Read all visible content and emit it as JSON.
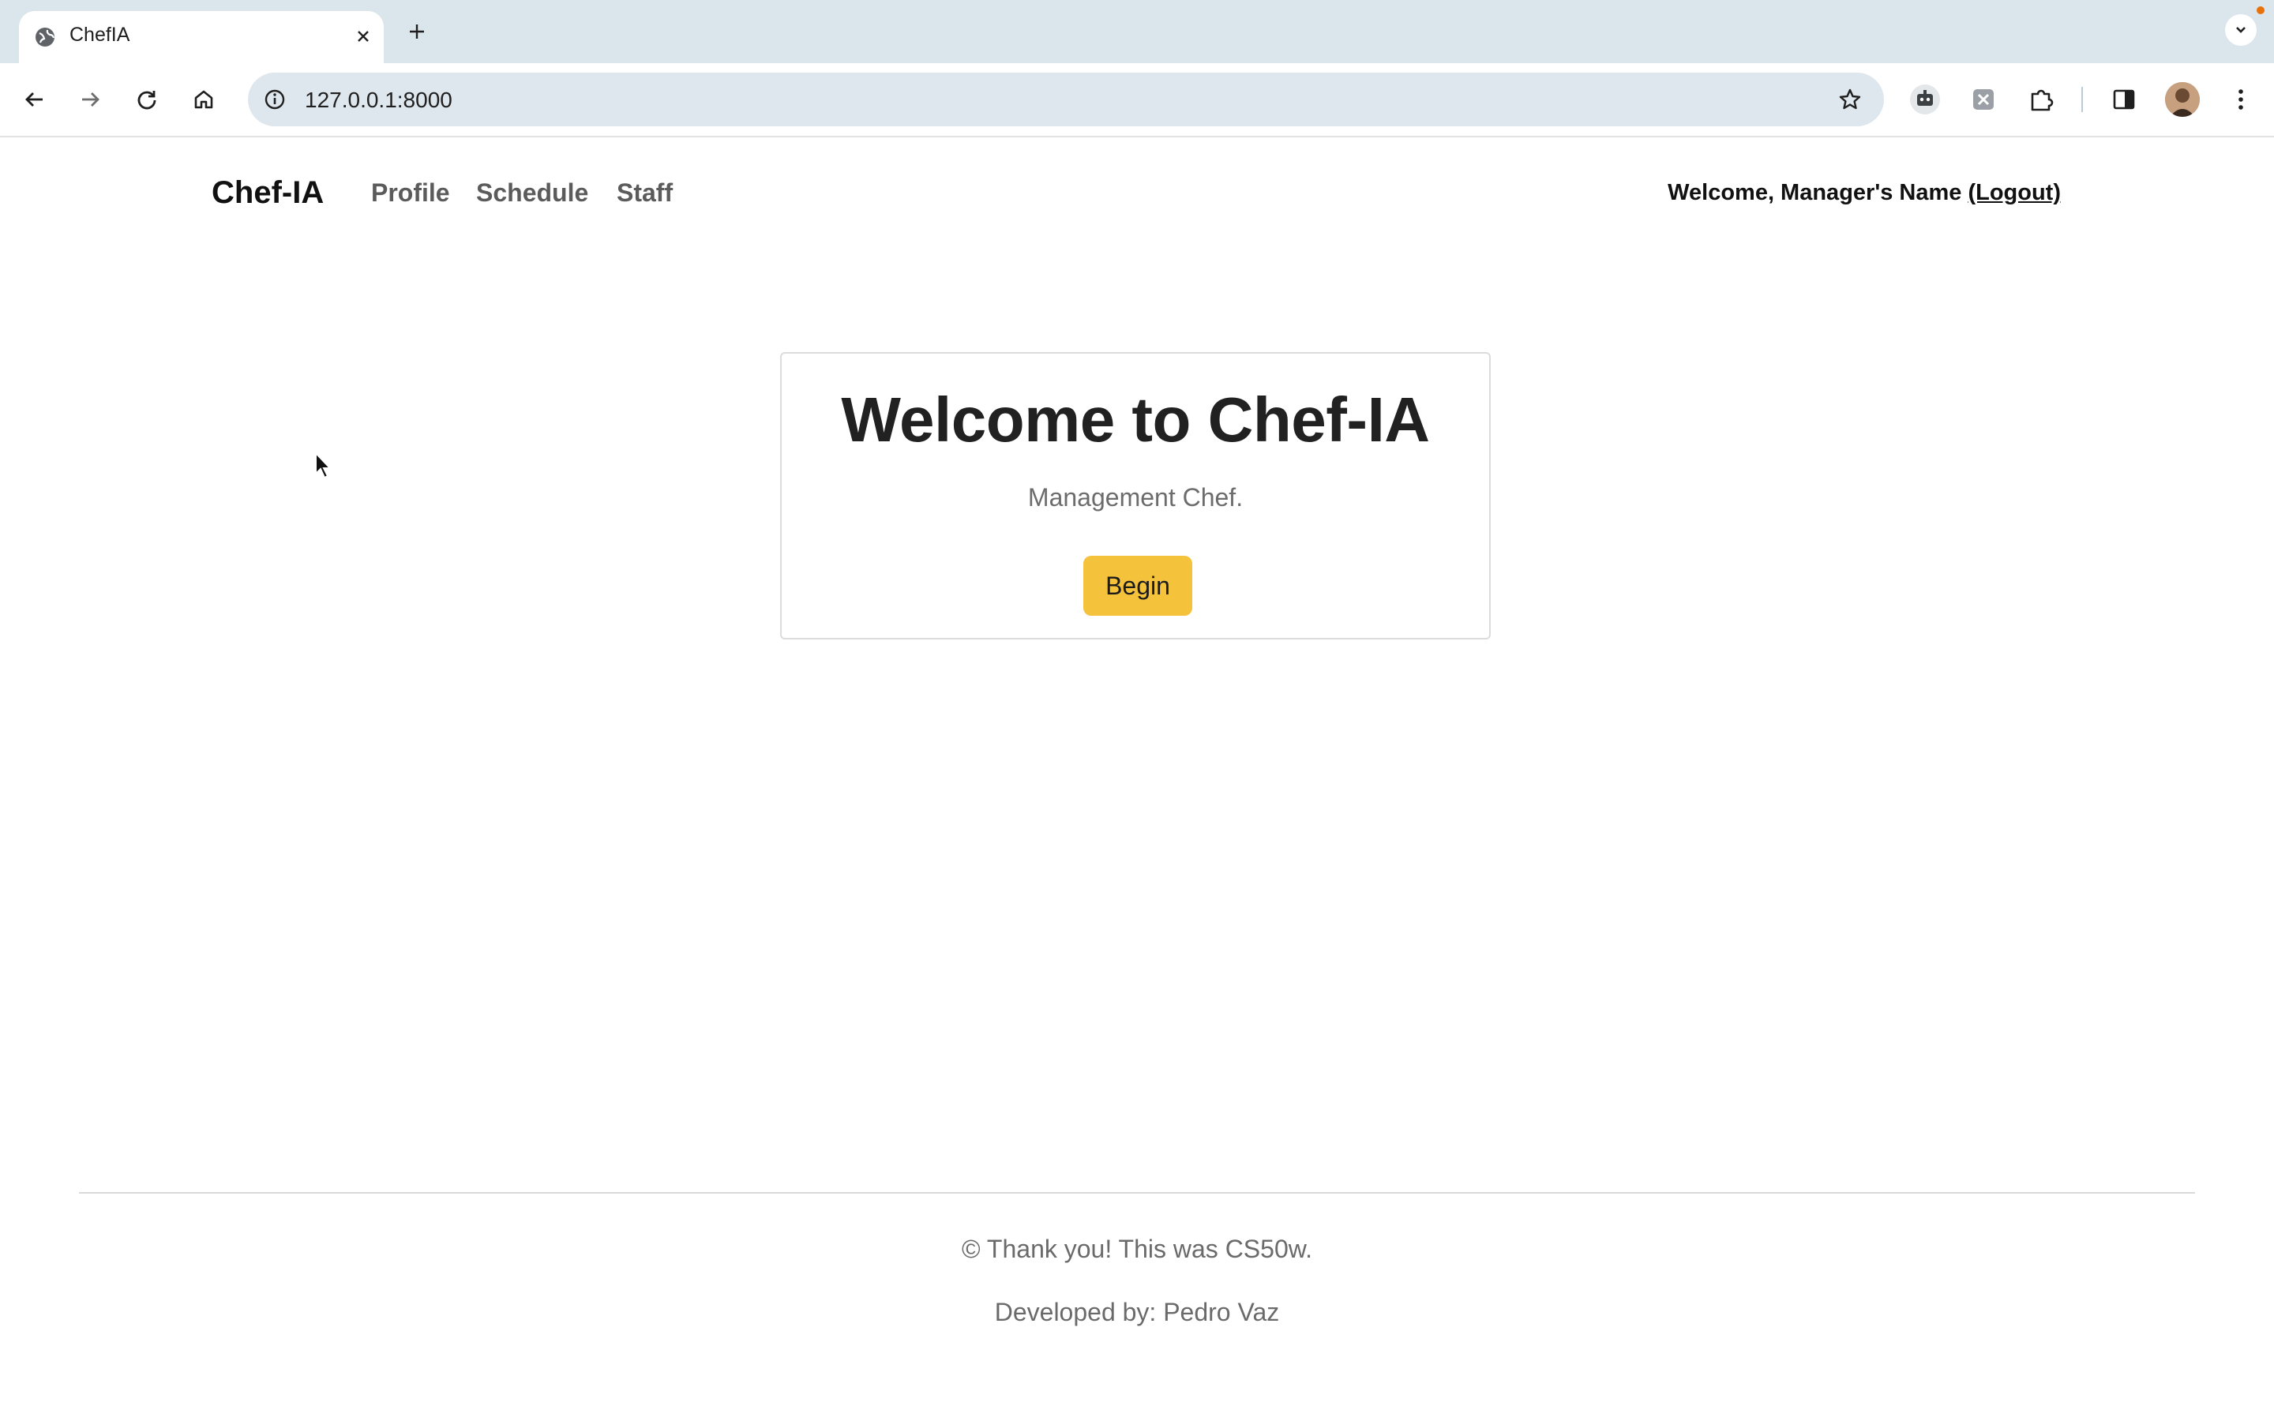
{
  "browser": {
    "tab_title": "ChefIA",
    "url": "127.0.0.1:8000",
    "icons": {
      "favicon": "globe-icon",
      "tab_close": "close-icon",
      "new_tab": "plus-icon",
      "tab_search": "chevron-down-icon",
      "back": "back-arrow-icon",
      "forward": "forward-arrow-icon",
      "reload": "reload-icon",
      "home": "home-icon",
      "site_info": "info-icon",
      "bookmark": "star-icon",
      "extensions": [
        "robot-icon",
        "puzzle-grey-icon",
        "puzzle-icon"
      ],
      "side_panel": "side-panel-icon",
      "profile": "avatar",
      "menu": "kebab-menu-icon"
    }
  },
  "nav": {
    "brand": "Chef-IA",
    "links": [
      "Profile",
      "Schedule",
      "Staff"
    ],
    "welcome_text": "Welcome, Manager's Name ",
    "logout": "(Logout)"
  },
  "hero": {
    "title": "Welcome to Chef-IA",
    "subtitle": "Management Chef.",
    "button": "Begin"
  },
  "footer": {
    "line1": "© Thank you! This was CS50w.",
    "line2": "Developed by: Pedro Vaz"
  },
  "colors": {
    "button_bg": "#f5c33b",
    "tabstrip_bg": "#dbe5ec",
    "omnibox_bg": "#dfe7ee"
  }
}
